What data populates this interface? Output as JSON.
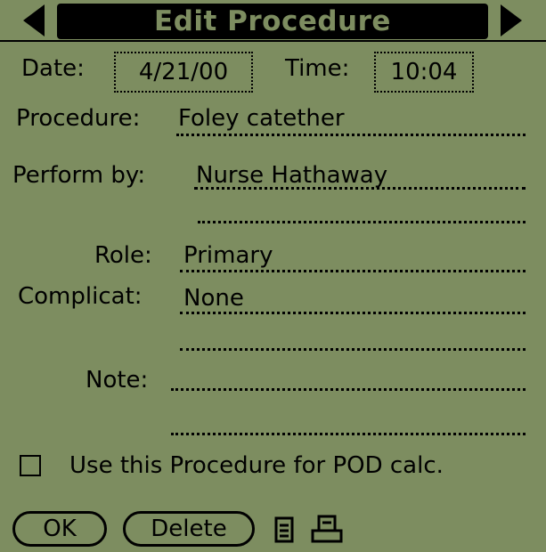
{
  "title": "Edit Procedure",
  "icons": {
    "prev": "arrow-left-icon",
    "next": "arrow-right-icon",
    "note": "note-icon",
    "print": "print-icon"
  },
  "date": {
    "label": "Date:",
    "value": "4/21/00"
  },
  "time": {
    "label": "Time:",
    "value": "10:04"
  },
  "procedure": {
    "label": "Procedure:",
    "value": "Foley catether"
  },
  "performed_by": {
    "label": "Perform by:",
    "value": "Nurse Hathaway",
    "value2": ""
  },
  "role": {
    "label": "Role:",
    "value": "Primary"
  },
  "complication": {
    "label": "Complicat:",
    "value": "None"
  },
  "note": {
    "label": "Note:",
    "value": ""
  },
  "pod_checkbox": {
    "label": "Use this Procedure for POD calc.",
    "checked": false
  },
  "buttons": {
    "ok": "OK",
    "delete": "Delete"
  },
  "colors": {
    "screen": "#7d8d60",
    "ink": "#000000"
  }
}
